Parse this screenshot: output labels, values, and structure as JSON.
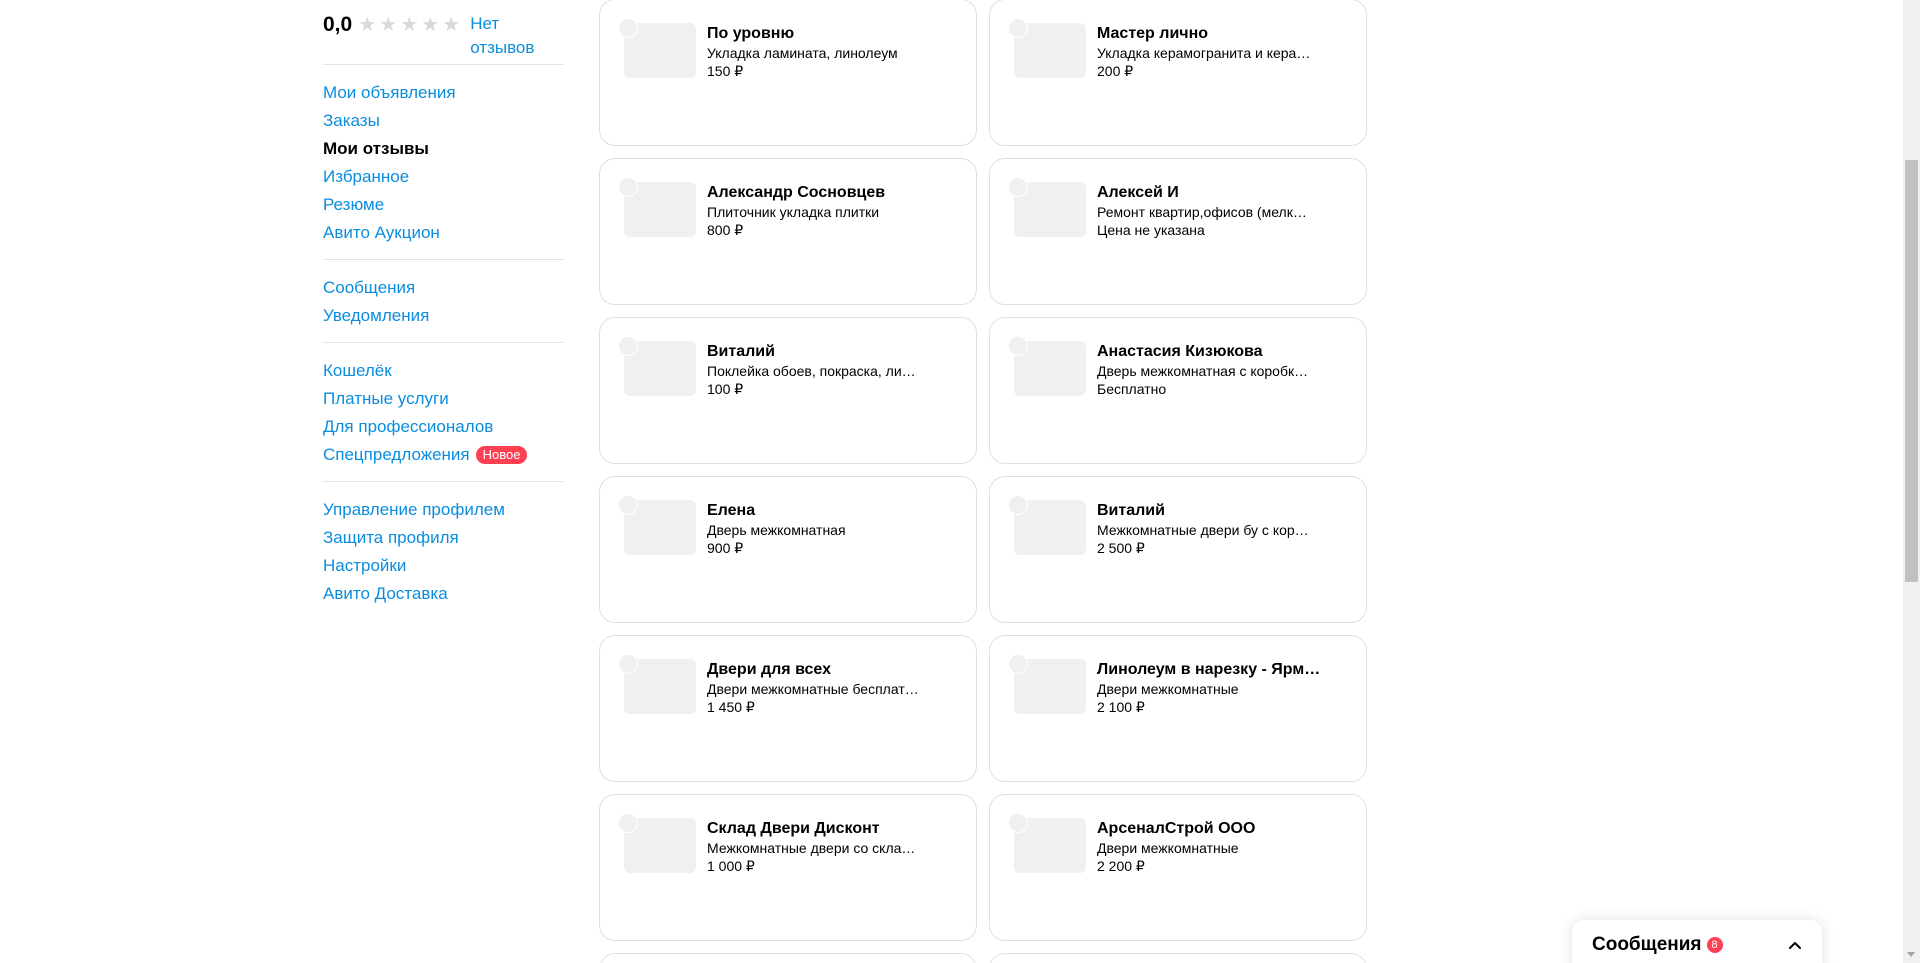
{
  "sidebar": {
    "rating": "0,0",
    "stars": [
      "★",
      "★",
      "★",
      "★",
      "★"
    ],
    "no_reviews": "Нет\nотзывов",
    "group1": [
      {
        "label": "Мои объявления"
      },
      {
        "label": "Заказы"
      },
      {
        "label": "Мои отзывы",
        "active": true
      },
      {
        "label": "Избранное"
      },
      {
        "label": "Резюме"
      },
      {
        "label": "Авито Аукцион"
      }
    ],
    "group2": [
      {
        "label": "Сообщения"
      },
      {
        "label": "Уведомления"
      }
    ],
    "group3": [
      {
        "label": "Кошелёк"
      },
      {
        "label": "Платные услуги"
      },
      {
        "label": "Для профессионалов"
      },
      {
        "label": "Спецпредложения",
        "badge": "Новое"
      }
    ],
    "group4": [
      {
        "label": "Управление профилем"
      },
      {
        "label": "Защита профиля"
      },
      {
        "label": "Настройки"
      },
      {
        "label": "Авито Доставка"
      }
    ]
  },
  "cards": [
    {
      "title": "По уровню",
      "subtitle": "Укладка ламината, линолеум",
      "price": "150 ₽"
    },
    {
      "title": "Мастер лично",
      "subtitle": "Укладка керамогранита и кера…",
      "price": "200 ₽"
    },
    {
      "title": "Александр Сосновцев",
      "subtitle": "Плиточник укладка плитки",
      "price": "800 ₽"
    },
    {
      "title": "Алексей И",
      "subtitle": "Ремонт квартир,офисов (мелк…",
      "price": "Цена не указана"
    },
    {
      "title": "Виталий",
      "subtitle": "Поклейка обоев, покраска, ли…",
      "price": "100 ₽"
    },
    {
      "title": "Анастасия Кизюкова",
      "subtitle": "Дверь межкомнатная с коробк…",
      "price": "Бесплатно"
    },
    {
      "title": "Елена",
      "subtitle": "Дверь межкомнатная",
      "price": "900 ₽"
    },
    {
      "title": "Виталий",
      "subtitle": "Межкомнатные двери бу с кор…",
      "price": "2 500 ₽"
    },
    {
      "title": "Двери для всех",
      "subtitle": "Двери межкомнатные бесплат…",
      "price": "1 450 ₽"
    },
    {
      "title": "Линолеум в нарезку - Ярм…",
      "subtitle": "Двери межкомнатные",
      "price": "2 100 ₽"
    },
    {
      "title": "Склад Двери Дисконт",
      "subtitle": "Межкомнатные двери со скла…",
      "price": "1 000 ₽"
    },
    {
      "title": "АрсеналСтрой ООО",
      "subtitle": "Двери межкомнатные",
      "price": "2 200 ₽"
    }
  ],
  "messages_widget": {
    "label": "Сообщения",
    "count": "8"
  },
  "colors": {
    "link": "#0a8ddf",
    "badge": "#ff4053",
    "border": "#e0e0e0"
  }
}
